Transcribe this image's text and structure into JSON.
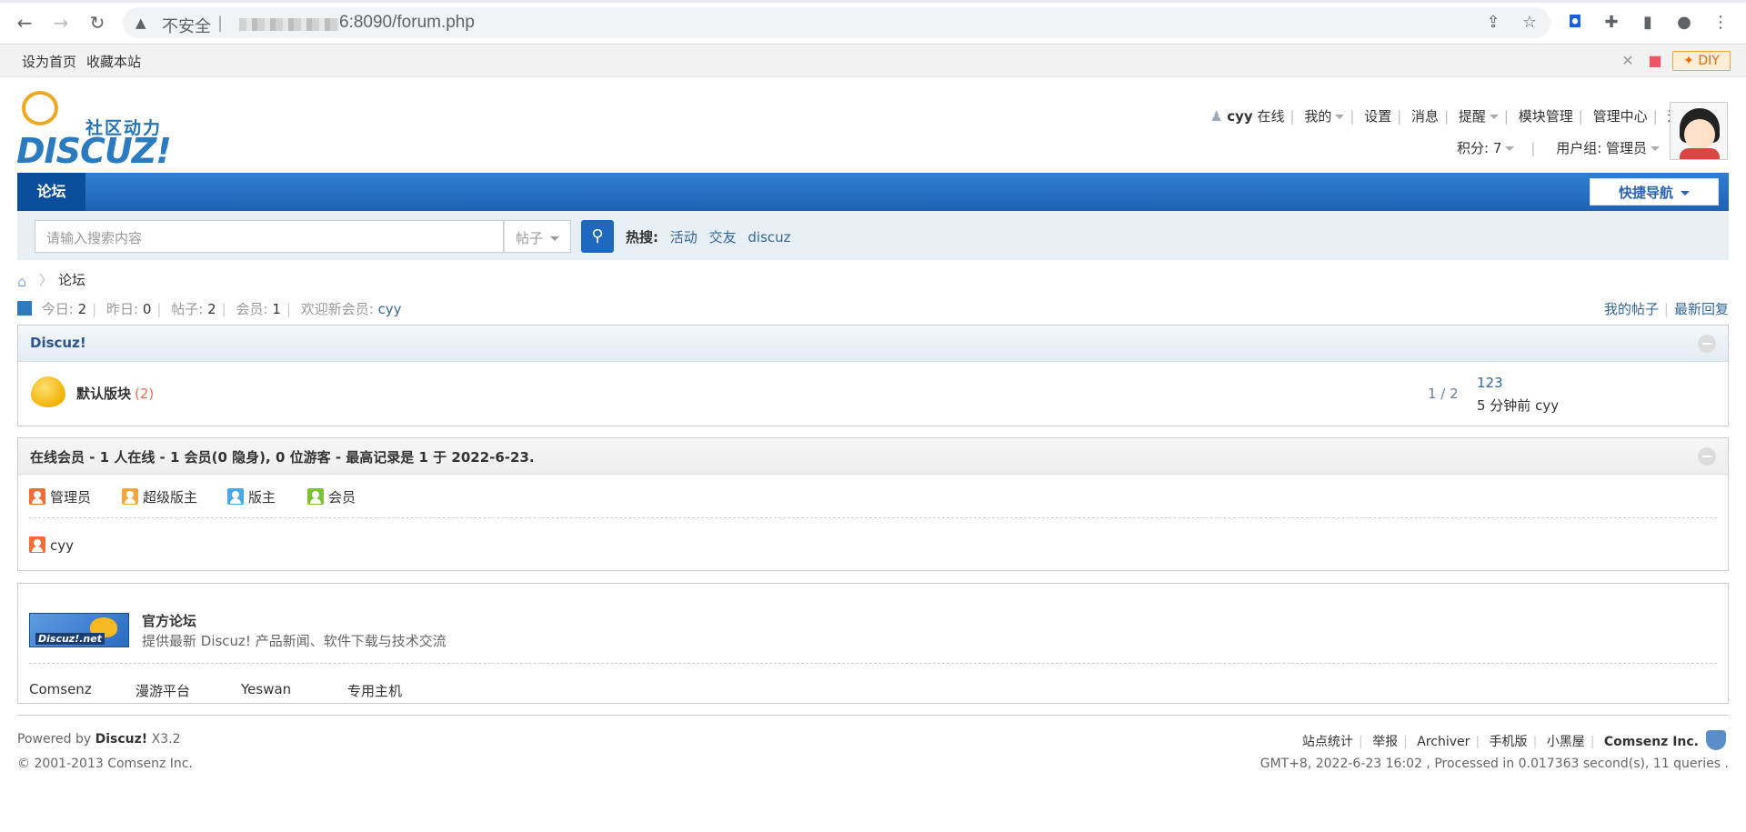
{
  "browser": {
    "insecure_label": "不安全",
    "separator": "|",
    "url": "6:8090/forum.php"
  },
  "topbar": {
    "set_home": "设为首页",
    "bookmark": "收藏本站",
    "diy": "✦ DIY"
  },
  "header": {
    "slogan": "社区动力",
    "logo_text": "DISCUZ!",
    "username": "cyy",
    "online": "在线",
    "menu": [
      "我的",
      "设置",
      "消息",
      "提醒",
      "模块管理",
      "管理中心",
      "退出"
    ],
    "credits": "积分: 7",
    "usergroup": "用户组: 管理员"
  },
  "nav": {
    "forum_tab": "论坛",
    "quick_nav": "快捷导航"
  },
  "search": {
    "placeholder": "请输入搜索内容",
    "type": "帖子",
    "hot_label": "热搜:",
    "hot_terms": [
      "活动",
      "交友",
      "discuz"
    ]
  },
  "breadcrumb": {
    "current": "论坛"
  },
  "stats": {
    "today_label": "今日:",
    "today": "2",
    "yesterday_label": "昨日:",
    "yesterday": "0",
    "posts_label": "帖子:",
    "posts": "2",
    "members_label": "会员:",
    "members": "1",
    "welcome_label": "欢迎新会员:",
    "newest": "cyy",
    "my_posts": "我的帖子",
    "latest_replies": "最新回复"
  },
  "category": {
    "title": "Discuz!",
    "forums": [
      {
        "name": "默认版块",
        "new_count": "(2)",
        "threads_posts": "1 / 2",
        "last_title": "123",
        "last_meta": "5 分钟前 cyy"
      }
    ]
  },
  "online": {
    "title": "在线会员 - 1 人在线 - 1 会员(0 隐身), 0 位游客 - 最高记录是 1 于 2022-6-23.",
    "legend": [
      {
        "label": "管理员",
        "color": "#f26c37"
      },
      {
        "label": "超级版主",
        "color": "#f7a33b"
      },
      {
        "label": "版主",
        "color": "#4aa7e5"
      },
      {
        "label": "会员",
        "color": "#7cc234"
      }
    ],
    "users": [
      "cyy"
    ]
  },
  "friendlinks": {
    "logo_text": "Discuz!.net",
    "title": "官方论坛",
    "desc": "提供最新 Discuz! 产品新闻、软件下载与技术交流",
    "text_links": [
      "Comsenz",
      "漫游平台",
      "Yeswan",
      "专用主机"
    ]
  },
  "footer": {
    "powered_prefix": "Powered by",
    "powered_product": "Discuz!",
    "version": "X3.2",
    "copyright": "© 2001-2013 Comsenz Inc.",
    "links": [
      "站点统计",
      "举报",
      "Archiver",
      "手机版",
      "小黑屋"
    ],
    "company": "Comsenz Inc.",
    "processed": "GMT+8, 2022-6-23 16:02 , Processed in 0.017363 second(s), 11 queries ."
  }
}
